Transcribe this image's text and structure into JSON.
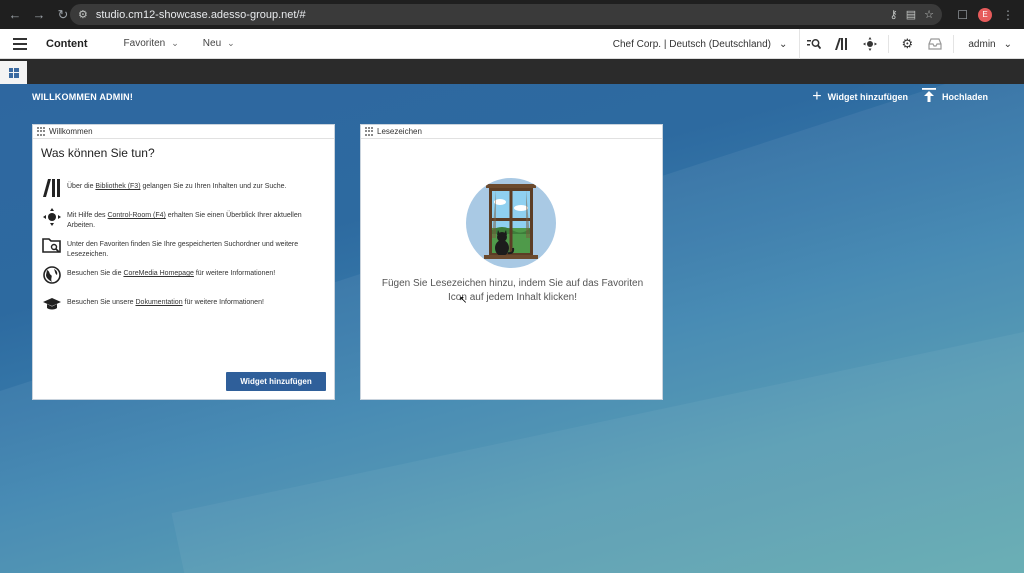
{
  "browser": {
    "url": "studio.cm12-showcase.adesso-group.net/#",
    "profile_initial": "E"
  },
  "app": {
    "title": "Content",
    "menus": [
      {
        "label": "Favoriten"
      },
      {
        "label": "Neu"
      }
    ],
    "site_selector": "Chef Corp. | Deutsch (Deutschland)",
    "user": "admin"
  },
  "dashboard": {
    "welcome": "WILLKOMMEN ADMIN!",
    "add_widget": "Widget hinzufügen",
    "upload": "Hochladen"
  },
  "welcome_widget": {
    "header": "Willkommen",
    "heading": "Was können Sie tun?",
    "rows": [
      {
        "icon": "library-icon",
        "pre": "Über die ",
        "link": "Bibliothek (F3)",
        "post": " gelangen Sie zu Ihren Inhalten und zur Suche."
      },
      {
        "icon": "control-room-icon",
        "pre": "Mit Hilfe des ",
        "link": "Control-Room (F4)",
        "post": " erhalten Sie einen Überblick Ihrer aktuellen Arbeiten."
      },
      {
        "icon": "favorites-folder-icon",
        "pre": "Unter den Favoriten finden Sie Ihre gespeicherten Suchordner und weitere Lesezeichen.",
        "link": "",
        "post": ""
      },
      {
        "icon": "globe-icon",
        "pre": "Besuchen Sie die ",
        "link": "CoreMedia Homepage",
        "post": " für weitere Informationen!"
      },
      {
        "icon": "graduation-cap-icon",
        "pre": "Besuchen Sie unsere ",
        "link": "Dokumentation",
        "post": " für weitere Informationen!"
      }
    ],
    "button": "Widget hinzufügen"
  },
  "bookmarks_widget": {
    "header": "Lesezeichen",
    "empty_text": "Fügen Sie Lesezeichen hinzu, indem Sie auf das Favoriten Icon auf jedem Inhalt klicken!"
  }
}
